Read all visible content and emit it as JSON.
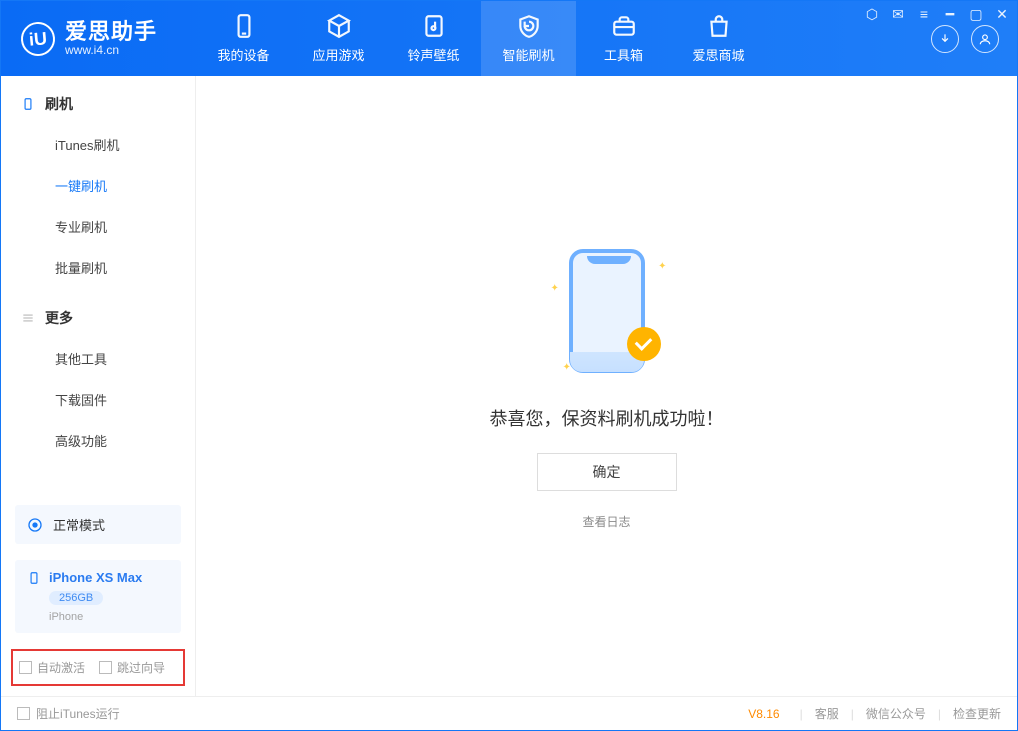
{
  "app": {
    "name": "爱思助手",
    "url": "www.i4.cn"
  },
  "tabs": {
    "device": "我的设备",
    "apps": "应用游戏",
    "ring": "铃声壁纸",
    "flash": "智能刷机",
    "toolbox": "工具箱",
    "store": "爱思商城"
  },
  "sidebar": {
    "group_flash": "刷机",
    "items_flash": {
      "itunes": "iTunes刷机",
      "oneclick": "一键刷机",
      "pro": "专业刷机",
      "batch": "批量刷机"
    },
    "group_more": "更多",
    "items_more": {
      "other": "其他工具",
      "firmware": "下载固件",
      "advanced": "高级功能"
    }
  },
  "mode": {
    "label": "正常模式"
  },
  "device": {
    "name": "iPhone XS Max",
    "capacity": "256GB",
    "type": "iPhone"
  },
  "options": {
    "auto_activate": "自动激活",
    "skip_guide": "跳过向导"
  },
  "main": {
    "success_msg": "恭喜您，保资料刷机成功啦！",
    "ok": "确定",
    "view_log": "查看日志"
  },
  "footer": {
    "block_itunes": "阻止iTunes运行",
    "version": "V8.16",
    "support": "客服",
    "wechat": "微信公众号",
    "update": "检查更新"
  }
}
